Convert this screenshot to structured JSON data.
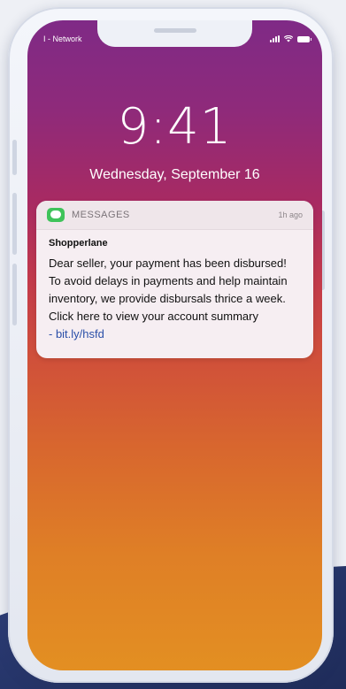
{
  "status_bar": {
    "carrier": "I - Network",
    "icons": [
      "signal-icon",
      "wifi-icon",
      "battery-icon"
    ]
  },
  "lock_screen": {
    "time": "9:41",
    "date": "Wednesday, September 16"
  },
  "notification": {
    "app_name": "MESSAGES",
    "app_icon": "messages-icon",
    "app_icon_color": "#3fc35a",
    "time_ago": "1h ago",
    "sender": "Shopperlane",
    "lines": [
      "Dear seller, your payment has been disbursed!",
      "To avoid delays in payments and help maintain",
      "inventory, we provide disbursals thrice a week.",
      "Click here to view your account summary"
    ],
    "link": "- bit.ly/hsfd"
  }
}
